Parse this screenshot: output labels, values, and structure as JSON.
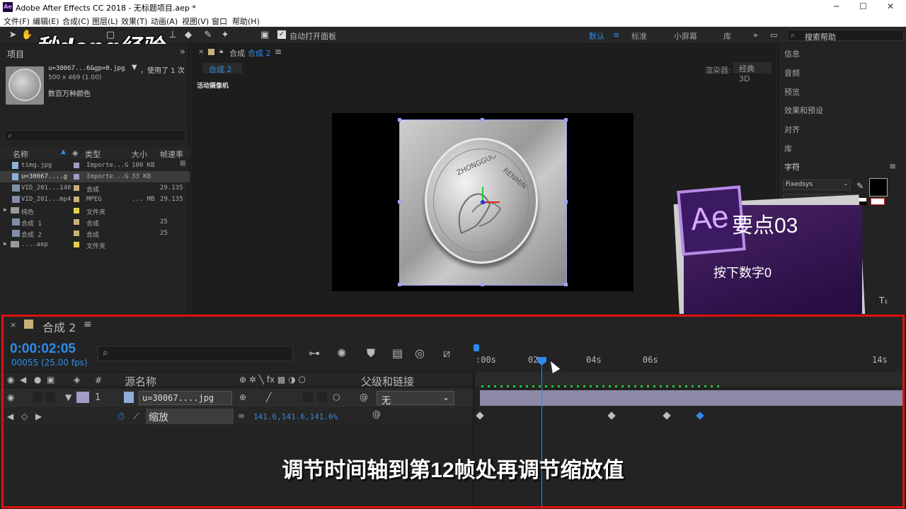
{
  "window": {
    "title": "Adobe After Effects CC 2018 - 无标题项目.aep *",
    "app_icon": "Ae",
    "minimize": "─",
    "maximize": "☐",
    "close": "✕"
  },
  "menu": [
    "文件(F)",
    "编辑(E)",
    "合成(C)",
    "图层(L)",
    "效果(T)",
    "动画(A)",
    "视图(V)",
    "窗口",
    "帮助(H)"
  ],
  "toolbar": {
    "auto_open_label": "自动打开面板",
    "workspaces": [
      "默认",
      "标准",
      "小屏幕",
      "库"
    ],
    "active_workspace": "默认",
    "search_placeholder": "搜索帮助"
  },
  "watermark": "秒dong经验",
  "project": {
    "tab": "项目",
    "selected_name": "u=30067...6&gp=0.jpg",
    "used_count": "，使用了 1 次",
    "dimensions": "500 x 469 (1.00)",
    "colors": "数百万种颜色",
    "columns": {
      "name": "名称",
      "type": "类型",
      "size": "大小",
      "fps": "帧速率"
    },
    "files": [
      {
        "name": "timg.jpg",
        "type": "Importe...G",
        "size": "100 KB",
        "fps": "",
        "color": "#a49ac8"
      },
      {
        "name": "u=30067....g",
        "type": "Importe...G",
        "size": "33 KB",
        "fps": "",
        "color": "#a49ac8"
      },
      {
        "name": "VID_201...140",
        "type": "合成",
        "size": "",
        "fps": "29.135",
        "color": "#c9b27a"
      },
      {
        "name": "VID_201...mp4",
        "type": "MPEG",
        "size": "... MB",
        "fps": "29.135",
        "color": "#c9b27a"
      },
      {
        "name": "纯色",
        "type": "文件夹",
        "size": "",
        "fps": "",
        "color": "#e6cf4a"
      },
      {
        "name": "合成 1",
        "type": "合成",
        "size": "",
        "fps": "25",
        "color": "#c9b27a"
      },
      {
        "name": "合成 2",
        "type": "合成",
        "size": "",
        "fps": "25",
        "color": "#c9b27a"
      },
      {
        "name": "....aep",
        "type": "文件夹",
        "size": "",
        "fps": "",
        "color": "#e6cf4a"
      }
    ]
  },
  "viewer": {
    "tab_prefix": "合成",
    "tab_name": "合成 2",
    "crumb": "合成 2",
    "renderer_label": "渲染器:",
    "renderer_value": "经典 3D",
    "camera_label": "活动摄像机"
  },
  "right_panel": [
    "信息",
    "音频",
    "预览",
    "效果和预设",
    "对齐",
    "库",
    "字符"
  ],
  "character": {
    "font": "Fixedsys",
    "sub": "-"
  },
  "card": {
    "logo": "Ae",
    "title": "要点03",
    "subtitle": "按下数字0"
  },
  "timeline": {
    "tab": "合成 2",
    "timecode": "0:00:02:05",
    "frames": "00055 (25.00 fps)",
    "columns": {
      "hash": "#",
      "source": "源名称",
      "parent": "父级和链接"
    },
    "layer": {
      "index": "1",
      "name": "u=30067....jpg",
      "parent": "无"
    },
    "property": {
      "name": "缩放",
      "value": "141.6,141.6,141.6%"
    },
    "ruler": [
      ":00s",
      "02",
      "04s",
      "06s",
      "14s"
    ]
  },
  "subtitle": "调节时间轴到第12帧处再调节缩放值"
}
